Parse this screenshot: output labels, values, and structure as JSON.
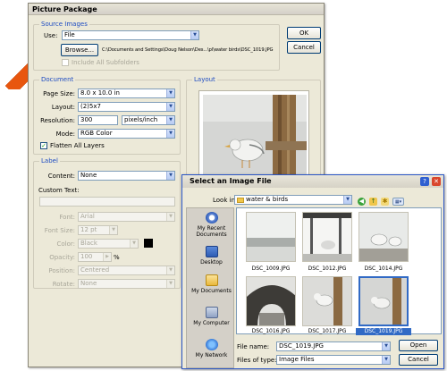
{
  "picture_package": {
    "title": "Picture Package",
    "source_images": {
      "group_title": "Source Images",
      "use_label": "Use:",
      "use_value": "File",
      "browse_label": "Browse...",
      "path": "C:\\Documents and Settings\\Doug Nelson\\Des...\\pl\\water birds\\DSC_1019.JPG",
      "include_subfolders_label": "Include All Subfolders"
    },
    "buttons": {
      "ok": "OK",
      "cancel": "Cancel"
    },
    "document": {
      "group_title": "Document",
      "page_size_label": "Page Size:",
      "page_size_value": "8.0 x 10.0 in",
      "layout_label": "Layout:",
      "layout_value": "(2)5x7",
      "resolution_label": "Resolution:",
      "resolution_value": "300",
      "resolution_unit": "pixels/inch",
      "mode_label": "Mode:",
      "mode_value": "RGB Color",
      "flatten_label": "Flatten All Layers"
    },
    "label": {
      "group_title": "Label",
      "content_label": "Content:",
      "content_value": "None",
      "custom_text_label": "Custom Text:",
      "font_label": "Font:",
      "font_value": "Arial",
      "font_size_label": "Font Size:",
      "font_size_value": "12 pt",
      "color_label": "Color:",
      "color_value": "Black",
      "opacity_label": "Opacity:",
      "opacity_value": "100",
      "opacity_unit": "%",
      "position_label": "Position:",
      "position_value": "Centered",
      "rotate_label": "Rotate:",
      "rotate_value": "None"
    },
    "layout_preview": {
      "group_title": "Layout"
    }
  },
  "select_dialog": {
    "title": "Select an Image File",
    "look_in_label": "Look in:",
    "look_in_value": "water & birds",
    "places": [
      "My Recent Documents",
      "Desktop",
      "My Documents",
      "My Computer",
      "My Network"
    ],
    "files": [
      "DSC_1009.JPG",
      "DSC_1012.JPG",
      "DSC_1014.JPG",
      "DSC_1016.JPG",
      "DSC_1017.JPG",
      "DSC_1019.JPG"
    ],
    "selected_file": "DSC_1019.JPG",
    "file_name_label": "File name:",
    "file_name_value": "DSC_1019.JPG",
    "files_of_type_label": "Files of type:",
    "files_of_type_value": "Image Files",
    "open_label": "Open",
    "cancel_label": "Cancel"
  },
  "colors": {
    "dialog_bg": "#ece9d8",
    "group_title_blue": "#1e4cc2",
    "arrow": "#e8560e",
    "close_button": "#d9462c"
  }
}
